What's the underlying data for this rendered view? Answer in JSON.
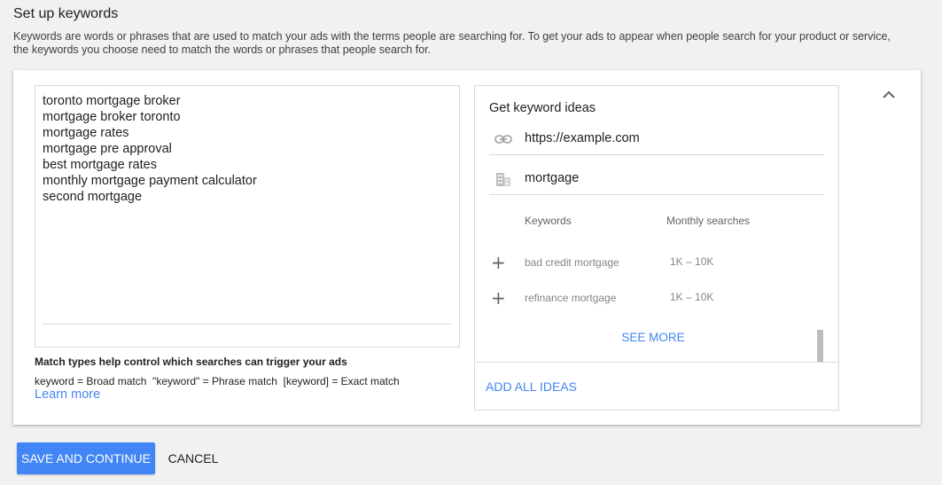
{
  "section": {
    "title": "Set up keywords",
    "description": "Keywords are words or phrases that are used to match your ads with the terms people are searching for. To get your ads to appear when people search for your product or service, the keywords you choose need to match the words or phrases that people search for."
  },
  "keywords_entry": {
    "keywords": [
      "toronto mortgage broker",
      "mortgage broker toronto",
      "mortgage rates",
      "mortgage pre approval",
      "best mortgage rates",
      "monthly mortgage payment calculator",
      "second mortgage"
    ]
  },
  "match_types": {
    "title": "Match types help control which searches can trigger your ads",
    "legend": "keyword = Broad match  \"keyword\" = Phrase match  [keyword] = Exact match",
    "learn_more": "Learn more"
  },
  "keyword_ideas": {
    "title": "Get keyword ideas",
    "url_value": "https://example.com",
    "product_value": "mortgage",
    "col_keywords": "Keywords",
    "col_monthly": "Monthly searches",
    "suggestions": [
      {
        "term": "bad credit mortgage",
        "volume": "1K – 10K"
      },
      {
        "term": "refinance mortgage",
        "volume": "1K – 10K"
      }
    ],
    "see_more": "SEE MORE",
    "add_all": "ADD ALL IDEAS",
    "icons": {
      "url": "link-icon",
      "product": "business-icon",
      "add": "plus-icon",
      "collapse": "chevron-up-icon"
    }
  },
  "actions": {
    "save": "SAVE AND CONTINUE",
    "cancel": "CANCEL"
  },
  "colors": {
    "accent": "#4285f4",
    "page_bg": "#f1f1f1"
  }
}
